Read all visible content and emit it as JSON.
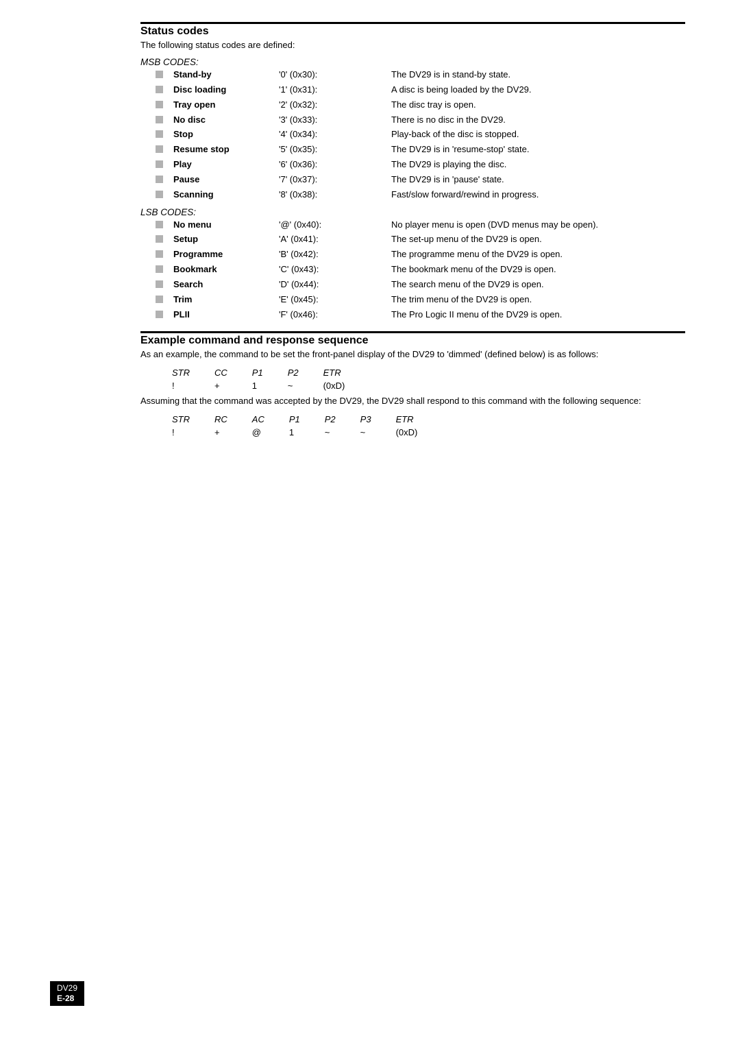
{
  "section1": {
    "title": "Status codes",
    "intro": "The following status codes are defined:",
    "msb_label": "MSB CODES:",
    "lsb_label": "LSB CODES:",
    "msb": [
      {
        "name": "Stand-by",
        "code": "'0' (0x30):",
        "desc": "The DV29 is in stand-by state."
      },
      {
        "name": "Disc loading",
        "code": "'1' (0x31):",
        "desc": "A disc is being loaded by the DV29."
      },
      {
        "name": "Tray open",
        "code": "'2' (0x32):",
        "desc": "The disc tray is open."
      },
      {
        "name": "No disc",
        "code": "'3' (0x33):",
        "desc": "There is no disc in the DV29."
      },
      {
        "name": "Stop",
        "code": "'4' (0x34):",
        "desc": "Play-back of the disc is stopped."
      },
      {
        "name": "Resume stop",
        "code": "'5' (0x35):",
        "desc": "The DV29 is in 'resume-stop' state."
      },
      {
        "name": "Play",
        "code": "'6' (0x36):",
        "desc": "The DV29 is playing the disc."
      },
      {
        "name": "Pause",
        "code": "'7' (0x37):",
        "desc": "The DV29 is in 'pause' state."
      },
      {
        "name": "Scanning",
        "code": "'8' (0x38):",
        "desc": "Fast/slow forward/rewind in progress."
      }
    ],
    "lsb": [
      {
        "name": "No menu",
        "code": "'@' (0x40):",
        "desc": "No player menu is open (DVD menus may be open)."
      },
      {
        "name": "Setup",
        "code": "'A' (0x41):",
        "desc": "The set-up menu of the DV29 is open."
      },
      {
        "name": "Programme",
        "code": "'B' (0x42):",
        "desc": "The programme menu of the DV29 is open."
      },
      {
        "name": "Bookmark",
        "code": "'C' (0x43):",
        "desc": "The bookmark menu of the DV29 is open."
      },
      {
        "name": "Search",
        "code": "'D' (0x44):",
        "desc": "The search menu of the DV29 is open."
      },
      {
        "name": "Trim",
        "code": "'E' (0x45):",
        "desc": "The trim menu of the DV29 is open."
      },
      {
        "name": "PLII",
        "code": "'F' (0x46):",
        "desc": "The Pro Logic II menu of the DV29 is open."
      }
    ]
  },
  "section2": {
    "title": "Example command and response sequence",
    "intro": "As an example, the command to be set the front-panel display of the DV29 to 'dimmed' (defined below) is as follows:",
    "cmd_hdr": [
      "STR",
      "CC",
      "P1",
      "P2",
      "ETR"
    ],
    "cmd_vals": [
      "!",
      "+",
      "1",
      "~",
      "(0xD)"
    ],
    "mid": "Assuming that the command was accepted by the DV29, the DV29 shall respond to this command with the following sequence:",
    "resp_hdr": [
      "STR",
      "RC",
      "AC",
      "P1",
      "P2",
      "P3",
      "ETR"
    ],
    "resp_vals": [
      "!",
      "+",
      "@",
      "1",
      "~",
      "~",
      "(0xD)"
    ]
  },
  "footer": {
    "product": "DV29",
    "page": "E-28"
  }
}
